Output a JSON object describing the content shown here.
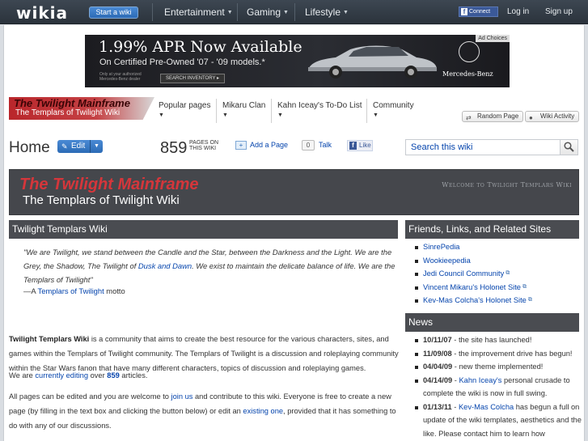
{
  "global_nav": {
    "logo": "wikia",
    "start_wiki": "Start a wiki",
    "hubs": [
      "Entertainment",
      "Gaming",
      "Lifestyle"
    ],
    "facebook_connect": "Connect",
    "login": "Log in",
    "signup": "Sign up"
  },
  "ad": {
    "headline": "1.99% APR Now Available",
    "subline": "On Certified Pre-Owned '07 - '09 models.*",
    "small_print": "Only at your authorized Mercedes-Benz dealer",
    "button": "SEARCH INVENTORY ▸",
    "choices": "Ad Choices",
    "brand": "Mercedes-Benz"
  },
  "wiki_header": {
    "wordmark_title": "The Twilight Mainframe",
    "wordmark_subtitle": "The Templars of Twilight Wiki",
    "nav": [
      "Popular pages",
      "Mikaru Clan",
      "Kahn Iceay's To-Do List",
      "Community"
    ],
    "random_page": "Random Page",
    "wiki_activity": "Wiki Activity"
  },
  "page_header": {
    "title": "Home",
    "edit": "Edit",
    "page_count": "859",
    "pages_label_1": "PAGES ON",
    "pages_label_2": "THIS WIKI",
    "add_page": "Add a Page",
    "talk_count": "0",
    "talk": "Talk",
    "like": "Like",
    "search_placeholder": "Search this wiki"
  },
  "banner": {
    "title": "The Twilight Mainframe",
    "subtitle": "The Templars of Twilight Wiki",
    "welcome": "Welcome to Twilight Templars Wiki"
  },
  "main": {
    "heading": "Twilight Templars Wiki",
    "quote_pre": "\"We are Twilight, we stand between the Candle and the Star, between the Darkness and the Light. We are the Grey, the Shadow, The Twilight of ",
    "quote_link": "Dusk and Dawn",
    "quote_post": ". We exist to maintain the delicate balance of life. We are the Templars of Twilight\"",
    "attr_pre": "—A ",
    "attr_link": "Templars of Twilight",
    "attr_post": " motto",
    "p1_bold": "Twilight Templars Wiki",
    "p1_rest": " is a community that aims to create the best resource for the various characters, sites, and games within the Templars of Twilight community. The Templars of Twilight is a discussion and roleplaying community within the Star Wars fanon that have many different characters, topics of discussion and roleplaying games.",
    "p2_pre": "We are ",
    "p2_link": "currently editing",
    "p2_mid": " over ",
    "p2_count": "859",
    "p2_post": " articles.",
    "p3_pre": "All pages can be edited and you are welcome to ",
    "p3_link1": "join us",
    "p3_mid": " and contribute to this wiki. Everyone is free to create a new page (by filling in the text box and clicking the button below) or edit an ",
    "p3_link2": "existing one",
    "p3_post": ", provided that it has something to do with any of our discussions."
  },
  "links_box": {
    "heading": "Friends, Links, and Related Sites",
    "items": [
      "SinrePedia",
      "Wookieepedia",
      "Jedi Council Community",
      "Vincent Mikaru's Holonet Site",
      "Kev-Mas Colcha's Holonet Site"
    ]
  },
  "news_box": {
    "heading": "News",
    "items": [
      {
        "date": "10/11/07",
        "pre": " - the site has launched!",
        "link": "",
        "post": ""
      },
      {
        "date": "11/09/08",
        "pre": " - the improvement drive has begun!",
        "link": "",
        "post": ""
      },
      {
        "date": "04/04/09",
        "pre": " - new theme implemented!",
        "link": "",
        "post": ""
      },
      {
        "date": "04/14/09",
        "pre": " - ",
        "link": "Kahn Iceay's",
        "post": " personal crusade to complete the wiki is now in full swing."
      },
      {
        "date": "01/13/11",
        "pre": " - ",
        "link": "Kev-Mas Colcha",
        "post": " has begun a full on update of the wiki templates, aesthetics and the like. Please contact him to learn how"
      }
    ],
    "contact_link": "contact him"
  }
}
